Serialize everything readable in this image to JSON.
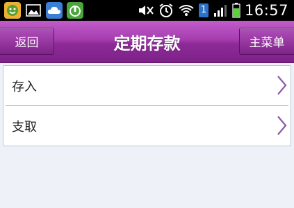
{
  "status_bar": {
    "time": "16:57",
    "left_icons": [
      "smiley-app-icon",
      "gallery-icon",
      "cloud-icon",
      "lock-app-icon"
    ],
    "right_icons": [
      "mute-icon",
      "alarm-icon",
      "wifi-icon",
      "sim-icon",
      "signal-icon",
      "battery-icon"
    ],
    "sim_slot": "1"
  },
  "header": {
    "back_label": "返回",
    "title": "定期存款",
    "menu_label": "主菜单",
    "colors": {
      "top": "#c15cc9",
      "bottom": "#7d2288"
    }
  },
  "list": {
    "items": [
      {
        "label": "存入",
        "icon": "chevron-right-icon"
      },
      {
        "label": "支取",
        "icon": "chevron-right-icon"
      }
    ]
  }
}
